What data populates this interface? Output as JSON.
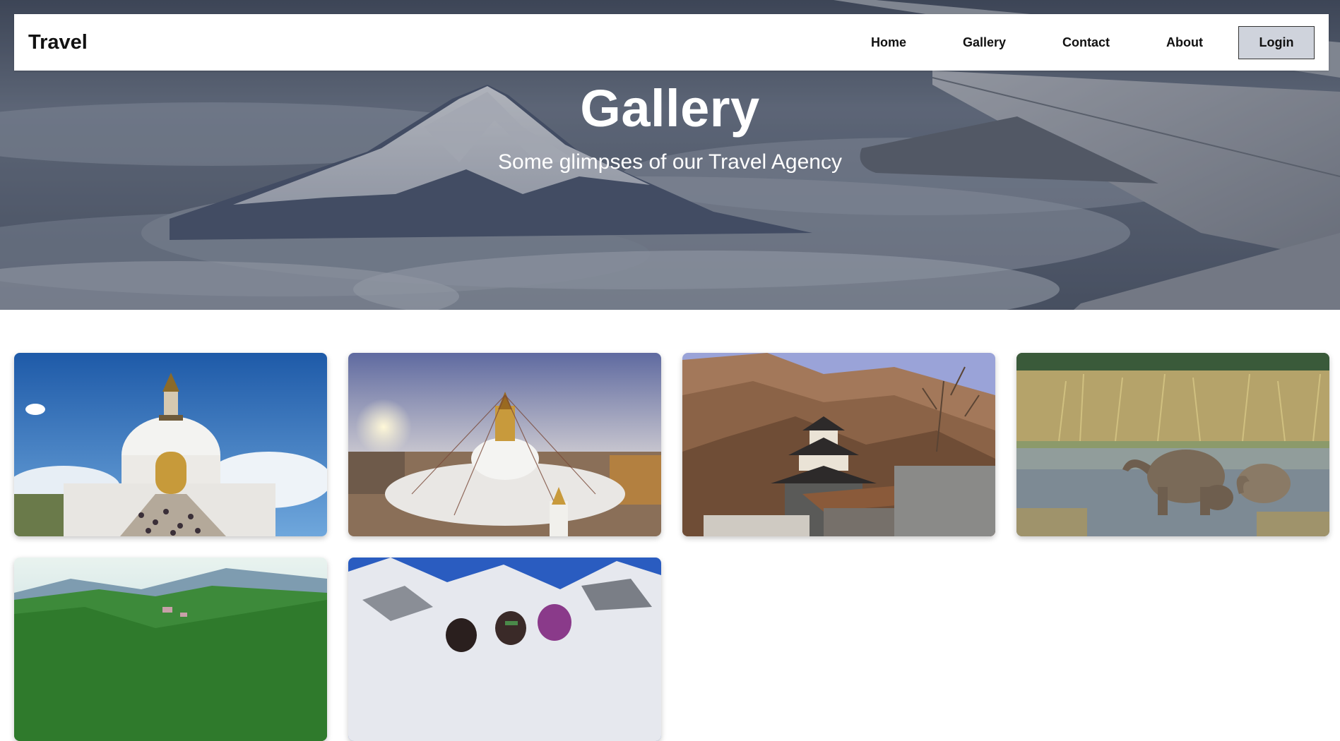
{
  "navbar": {
    "brand": "Travel",
    "links": [
      "Home",
      "Gallery",
      "Contact",
      "About"
    ],
    "login_label": "Login"
  },
  "hero": {
    "title": "Gallery",
    "subtitle": "Some glimpses of our Travel Agency"
  },
  "gallery": {
    "images": [
      "white-stupa-photo",
      "boudhanath-stupa-photo",
      "pagoda-temple-mountain-photo",
      "elephants-river-photo",
      "green-hills-tea-garden-photo",
      "climbers-snow-mountain-photo"
    ]
  },
  "colors": {
    "login_bg": "#cfd3dc",
    "hero_overlay": "#1c2436"
  }
}
